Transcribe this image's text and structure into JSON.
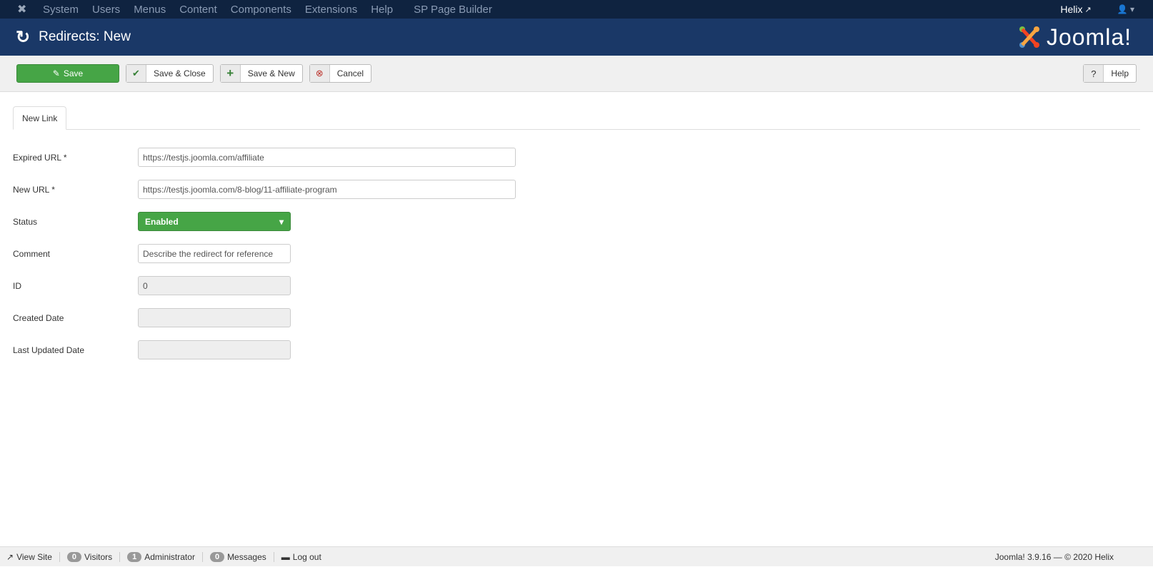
{
  "topnav": {
    "items": [
      "System",
      "Users",
      "Menus",
      "Content",
      "Components",
      "Extensions",
      "Help",
      "SP Page Builder"
    ],
    "site": "Helix"
  },
  "header": {
    "title": "Redirects: New",
    "brand": "Joomla!"
  },
  "toolbar": {
    "save": "Save",
    "save_close": "Save & Close",
    "save_new": "Save & New",
    "cancel": "Cancel",
    "help": "Help"
  },
  "tabs": [
    "New Link"
  ],
  "form": {
    "expired_label": "Expired URL *",
    "expired_value": "https://testjs.joomla.com/affiliate",
    "new_label": "New URL *",
    "new_value": "https://testjs.joomla.com/8-blog/11-affiliate-program",
    "status_label": "Status",
    "status_value": "Enabled",
    "comment_label": "Comment",
    "comment_placeholder": "Describe the redirect for reference",
    "id_label": "ID",
    "id_value": "0",
    "created_label": "Created Date",
    "updated_label": "Last Updated Date"
  },
  "footer": {
    "view_site": "View Site",
    "visitors_count": "0",
    "visitors": "Visitors",
    "admin_count": "1",
    "admin": "Administrator",
    "messages_count": "0",
    "messages": "Messages",
    "logout": "Log out",
    "version": "Joomla! 3.9.16  —  © 2020 Helix"
  },
  "colors": {
    "navbar": "#0f2340",
    "header": "#1a3867",
    "success": "#46a546"
  }
}
